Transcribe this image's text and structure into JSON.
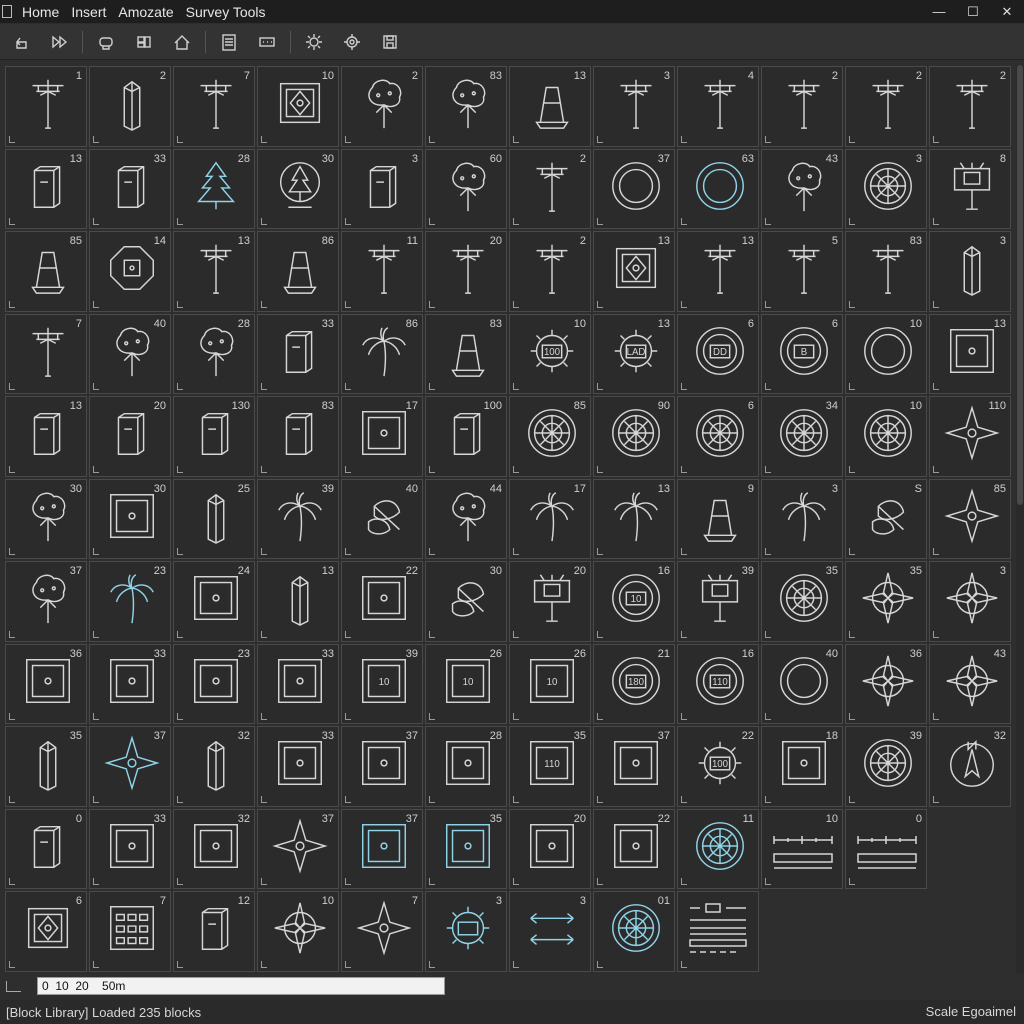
{
  "menubar": {
    "items": [
      "Home",
      "Insert",
      "Amozate",
      "Survey Tools"
    ],
    "window_controls": [
      "minimize-icon",
      "maximize-icon",
      "close-icon"
    ]
  },
  "toolbar": {
    "icons": [
      "undo-icon",
      "play-icon",
      "group-icon",
      "layers-icon",
      "home-icon",
      "list-icon",
      "dots-icon",
      "gear-icon",
      "settings-icon",
      "save-icon"
    ]
  },
  "grid": {
    "columns": 12,
    "tiles": [
      {
        "icon": "pole",
        "count": "1"
      },
      {
        "icon": "column",
        "count": "2"
      },
      {
        "icon": "pole",
        "count": "7"
      },
      {
        "icon": "panel",
        "count": "10"
      },
      {
        "icon": "tree",
        "count": "2"
      },
      {
        "icon": "tree",
        "count": "83"
      },
      {
        "icon": "cone",
        "count": "13"
      },
      {
        "icon": "pole",
        "count": "3"
      },
      {
        "icon": "pole",
        "count": "4"
      },
      {
        "icon": "pole",
        "count": "2"
      },
      {
        "icon": "pole",
        "count": "2"
      },
      {
        "icon": "pole",
        "count": "2"
      },
      {
        "icon": "box",
        "count": "13"
      },
      {
        "icon": "box",
        "count": "33"
      },
      {
        "icon": "pine",
        "count": "28",
        "accent": true
      },
      {
        "icon": "pine-circle",
        "count": "30"
      },
      {
        "icon": "box",
        "count": "3"
      },
      {
        "icon": "tree",
        "count": "60"
      },
      {
        "icon": "pole",
        "count": "2"
      },
      {
        "icon": "ring",
        "count": "37"
      },
      {
        "icon": "ring",
        "count": "63",
        "accent": true
      },
      {
        "icon": "tree",
        "count": "43"
      },
      {
        "icon": "manhole",
        "count": "3"
      },
      {
        "icon": "sign",
        "count": "8"
      },
      {
        "icon": "cone",
        "count": "85"
      },
      {
        "icon": "octagon",
        "count": "14"
      },
      {
        "icon": "pole",
        "count": "13"
      },
      {
        "icon": "cone",
        "count": "86"
      },
      {
        "icon": "pole",
        "count": "11"
      },
      {
        "icon": "pole",
        "count": "20"
      },
      {
        "icon": "pole",
        "count": "2"
      },
      {
        "icon": "panel",
        "count": "13"
      },
      {
        "icon": "pole",
        "count": "13"
      },
      {
        "icon": "pole",
        "count": "5"
      },
      {
        "icon": "pole",
        "count": "83"
      },
      {
        "icon": "column",
        "count": "3"
      },
      {
        "icon": "pole",
        "count": "7"
      },
      {
        "icon": "tree",
        "count": "40"
      },
      {
        "icon": "tree",
        "count": "28"
      },
      {
        "icon": "box",
        "count": "33"
      },
      {
        "icon": "palm",
        "count": "86"
      },
      {
        "icon": "cone",
        "count": "83"
      },
      {
        "icon": "gear",
        "count": "10",
        "label": "100"
      },
      {
        "icon": "gear",
        "count": "13",
        "label": "LAD"
      },
      {
        "icon": "ring",
        "count": "6",
        "label": "DD"
      },
      {
        "icon": "ring",
        "count": "6",
        "label": "B"
      },
      {
        "icon": "ring",
        "count": "10"
      },
      {
        "icon": "square",
        "count": "13"
      },
      {
        "icon": "box",
        "count": "13"
      },
      {
        "icon": "box",
        "count": "20"
      },
      {
        "icon": "box",
        "count": "130"
      },
      {
        "icon": "box",
        "count": "83"
      },
      {
        "icon": "square",
        "count": "17"
      },
      {
        "icon": "box",
        "count": "100"
      },
      {
        "icon": "manhole",
        "count": "85"
      },
      {
        "icon": "manhole",
        "count": "90"
      },
      {
        "icon": "manhole",
        "count": "6"
      },
      {
        "icon": "manhole",
        "count": "34"
      },
      {
        "icon": "manhole",
        "count": "10"
      },
      {
        "icon": "star",
        "count": "110"
      },
      {
        "icon": "tree",
        "count": "30"
      },
      {
        "icon": "square",
        "count": "30"
      },
      {
        "icon": "column",
        "count": "25"
      },
      {
        "icon": "palm",
        "count": "39"
      },
      {
        "icon": "leaf",
        "count": "40"
      },
      {
        "icon": "tree",
        "count": "44"
      },
      {
        "icon": "palm",
        "count": "17"
      },
      {
        "icon": "palm",
        "count": "13"
      },
      {
        "icon": "cone",
        "count": "9"
      },
      {
        "icon": "palm",
        "count": "3"
      },
      {
        "icon": "leaf",
        "count": "S"
      },
      {
        "icon": "star",
        "count": "85"
      },
      {
        "icon": "tree",
        "count": "37"
      },
      {
        "icon": "palm",
        "count": "23",
        "accent": true
      },
      {
        "icon": "square",
        "count": "24"
      },
      {
        "icon": "column",
        "count": "13"
      },
      {
        "icon": "square",
        "count": "22"
      },
      {
        "icon": "leaf",
        "count": "30"
      },
      {
        "icon": "sign",
        "count": "20"
      },
      {
        "icon": "ring",
        "count": "16",
        "label": "10"
      },
      {
        "icon": "sign",
        "count": "39"
      },
      {
        "icon": "manhole",
        "count": "35"
      },
      {
        "icon": "compass",
        "count": "35"
      },
      {
        "icon": "compass",
        "count": "3"
      },
      {
        "icon": "square",
        "count": "36"
      },
      {
        "icon": "square",
        "count": "33"
      },
      {
        "icon": "square",
        "count": "23"
      },
      {
        "icon": "square",
        "count": "33"
      },
      {
        "icon": "square",
        "count": "39",
        "label": "10"
      },
      {
        "icon": "square",
        "count": "26",
        "label": "10"
      },
      {
        "icon": "square",
        "count": "26",
        "label": "10"
      },
      {
        "icon": "ring",
        "count": "21",
        "label": "180"
      },
      {
        "icon": "ring",
        "count": "16",
        "label": "110"
      },
      {
        "icon": "ring",
        "count": "40"
      },
      {
        "icon": "compass",
        "count": "36"
      },
      {
        "icon": "compass",
        "count": "43"
      },
      {
        "icon": "column",
        "count": "35"
      },
      {
        "icon": "star",
        "count": "37",
        "accent": true
      },
      {
        "icon": "column",
        "count": "32"
      },
      {
        "icon": "square",
        "count": "33"
      },
      {
        "icon": "square",
        "count": "37"
      },
      {
        "icon": "square",
        "count": "28"
      },
      {
        "icon": "square",
        "count": "35",
        "label": "110"
      },
      {
        "icon": "square",
        "count": "37"
      },
      {
        "icon": "gear",
        "count": "22",
        "label": "100"
      },
      {
        "icon": "square",
        "count": "18"
      },
      {
        "icon": "manhole",
        "count": "39"
      },
      {
        "icon": "north",
        "count": "32"
      },
      {
        "icon": "box",
        "count": "0"
      },
      {
        "icon": "square",
        "count": "33"
      },
      {
        "icon": "square",
        "count": "32"
      },
      {
        "icon": "star",
        "count": "37"
      },
      {
        "icon": "square",
        "count": "37",
        "accent": true
      },
      {
        "icon": "square",
        "count": "35",
        "accent": true
      },
      {
        "icon": "square",
        "count": "20"
      },
      {
        "icon": "square",
        "count": "22"
      },
      {
        "icon": "manhole",
        "count": "11",
        "accent": true
      },
      {
        "icon": "scaleline",
        "count": "10",
        "wide": true
      },
      {
        "icon": "scaleline",
        "count": "0",
        "wide": true
      },
      {
        "icon": "empty"
      },
      {
        "icon": "panel",
        "count": "6"
      },
      {
        "icon": "grid",
        "count": "7"
      },
      {
        "icon": "box",
        "count": "12"
      },
      {
        "icon": "compass",
        "count": "10"
      },
      {
        "icon": "star",
        "count": "7"
      },
      {
        "icon": "gear",
        "count": "3",
        "accent": true
      },
      {
        "icon": "arrows",
        "count": "3",
        "accent": true
      },
      {
        "icon": "manhole",
        "count": "01",
        "accent": true
      },
      {
        "icon": "legend",
        "count": "",
        "wide": true
      },
      {
        "icon": "empty"
      },
      {
        "icon": "empty"
      },
      {
        "icon": "empty"
      }
    ]
  },
  "scale_input": {
    "value": "0  10  20    50m"
  },
  "status": {
    "text": "[Block Library] Loaded 235 blocks",
    "right": "Scale  Egoaimel"
  },
  "colors": {
    "accent": "#8fd3e8",
    "line": "#d6d6d6"
  }
}
